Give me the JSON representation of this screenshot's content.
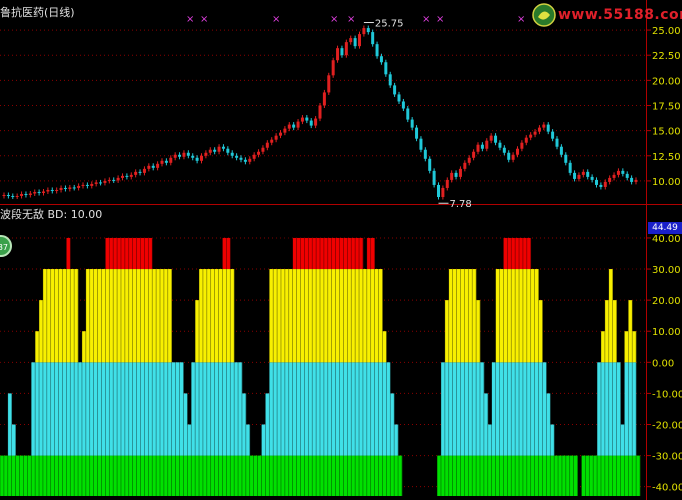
{
  "window": {
    "title": "鲁抗医药(日线)",
    "indicator_label": "波段无敌",
    "indicator_param": "BD: 10.00",
    "badge_text": "37",
    "last_value": "44.49"
  },
  "watermark": {
    "text": "www.55188.com",
    "logo_icon": "site-logo-icon"
  },
  "colors": {
    "background": "#000000",
    "axis": "#b00000",
    "grid": "#8a0000",
    "candle_up": "#e02020",
    "candle_down": "#20c8d8",
    "zone_green": "#00e000",
    "zone_cyan": "#40e0e8",
    "zone_yellow": "#f8f000",
    "zone_red": "#f00000",
    "marker": "#e040e0",
    "axis_text": "#e0e000"
  },
  "chart_data": [
    {
      "type": "candlestick",
      "title": "鲁抗医药(日线)",
      "ylim": [
        8.5,
        26.2
      ],
      "y_ticks": [
        "25.00",
        "22.50",
        "20.00",
        "17.50",
        "15.00",
        "12.50",
        "10.00"
      ],
      "annotations": [
        {
          "label": "25.75",
          "value": 25.75
        },
        {
          "label": "7.78",
          "value": 7.78
        }
      ],
      "top_markers": [
        "×",
        "×",
        "×",
        "×",
        "×",
        "×",
        "×",
        "×",
        "×"
      ],
      "series": [
        {
          "name": "close",
          "values": [
            8.6,
            8.5,
            8.45,
            8.5,
            8.7,
            8.6,
            8.75,
            8.9,
            8.8,
            8.95,
            9.1,
            9.0,
            9.1,
            9.3,
            9.2,
            9.35,
            9.3,
            9.5,
            9.6,
            9.5,
            9.7,
            9.85,
            9.8,
            10.0,
            10.1,
            10.05,
            10.3,
            10.5,
            10.4,
            10.6,
            10.9,
            10.8,
            11.2,
            11.5,
            11.3,
            11.7,
            12.0,
            11.8,
            12.3,
            12.6,
            12.4,
            12.8,
            12.5,
            12.3,
            12.0,
            12.5,
            12.8,
            13.1,
            12.9,
            13.4,
            13.2,
            12.8,
            12.5,
            12.3,
            12.1,
            11.9,
            12.2,
            12.6,
            12.9,
            13.3,
            13.8,
            14.1,
            14.5,
            14.8,
            15.2,
            15.6,
            15.3,
            15.9,
            16.3,
            16.0,
            15.5,
            16.2,
            17.5,
            18.8,
            20.5,
            22.0,
            23.2,
            22.5,
            23.8,
            24.2,
            23.4,
            24.6,
            25.2,
            24.8,
            23.6,
            22.4,
            21.8,
            20.6,
            19.5,
            18.6,
            17.9,
            17.2,
            16.1,
            15.3,
            14.2,
            13.1,
            12.2,
            11.0,
            9.6,
            8.4,
            9.3,
            10.1,
            10.8,
            10.4,
            11.2,
            11.8,
            12.3,
            12.9,
            13.6,
            13.2,
            14.0,
            14.5,
            13.8,
            13.3,
            12.8,
            12.1,
            12.6,
            13.2,
            13.8,
            14.3,
            14.6,
            14.9,
            15.3,
            15.6,
            14.9,
            14.2,
            13.4,
            12.6,
            11.8,
            10.8,
            10.2,
            10.6,
            10.9,
            10.4,
            10.1,
            9.6,
            9.4,
            9.9,
            10.3,
            10.6,
            11.0,
            10.7,
            10.3,
            9.9,
            10.1
          ]
        }
      ]
    },
    {
      "type": "area",
      "title": "波段无敌 BD: 10.00",
      "ylim": [
        -43,
        44.49
      ],
      "y_ticks": [
        "40.00",
        "30.00",
        "20.00",
        "10.00",
        "0.00",
        "-10.00",
        "-20.00",
        "-30.00",
        "-40.00"
      ],
      "levels": {
        "green": -30,
        "cyan": 0,
        "yellow": 30,
        "red": 44.49
      },
      "series": [
        {
          "name": "BD",
          "values": [
            -30,
            -30,
            -10,
            -20,
            -30,
            -30,
            -30,
            -30,
            0,
            10,
            20,
            30,
            30,
            30,
            30,
            30,
            30,
            40,
            30,
            30,
            0,
            10,
            30,
            30,
            30,
            30,
            30,
            40,
            40,
            40,
            40,
            40,
            40,
            40,
            40,
            40,
            40,
            40,
            40,
            30,
            30,
            30,
            30,
            30,
            0,
            0,
            0,
            -10,
            -20,
            0,
            20,
            30,
            30,
            30,
            30,
            30,
            30,
            40,
            40,
            30,
            0,
            0,
            -10,
            -20,
            -30,
            -30,
            -30,
            -20,
            -10,
            30,
            30,
            30,
            30,
            30,
            30,
            40,
            40,
            40,
            40,
            40,
            40,
            40,
            40,
            40,
            40,
            40,
            40,
            40,
            40,
            40,
            40,
            40,
            40,
            30,
            40,
            40,
            30,
            30,
            10,
            0,
            -10,
            -20,
            -30,
            -43,
            -43,
            -43,
            -43,
            -43,
            -43,
            -43,
            -43,
            -43,
            -30,
            0,
            20,
            30,
            30,
            30,
            30,
            30,
            30,
            30,
            20,
            0,
            -10,
            -20,
            0,
            30,
            30,
            40,
            40,
            40,
            40,
            40,
            40,
            40,
            30,
            30,
            20,
            0,
            -10,
            -20,
            -30,
            -30,
            -30,
            -30,
            -30,
            -30,
            -43,
            -30,
            -30,
            -30,
            -30,
            0,
            10,
            20,
            30,
            20,
            0,
            -20,
            10,
            20,
            10,
            -30
          ]
        }
      ]
    }
  ]
}
